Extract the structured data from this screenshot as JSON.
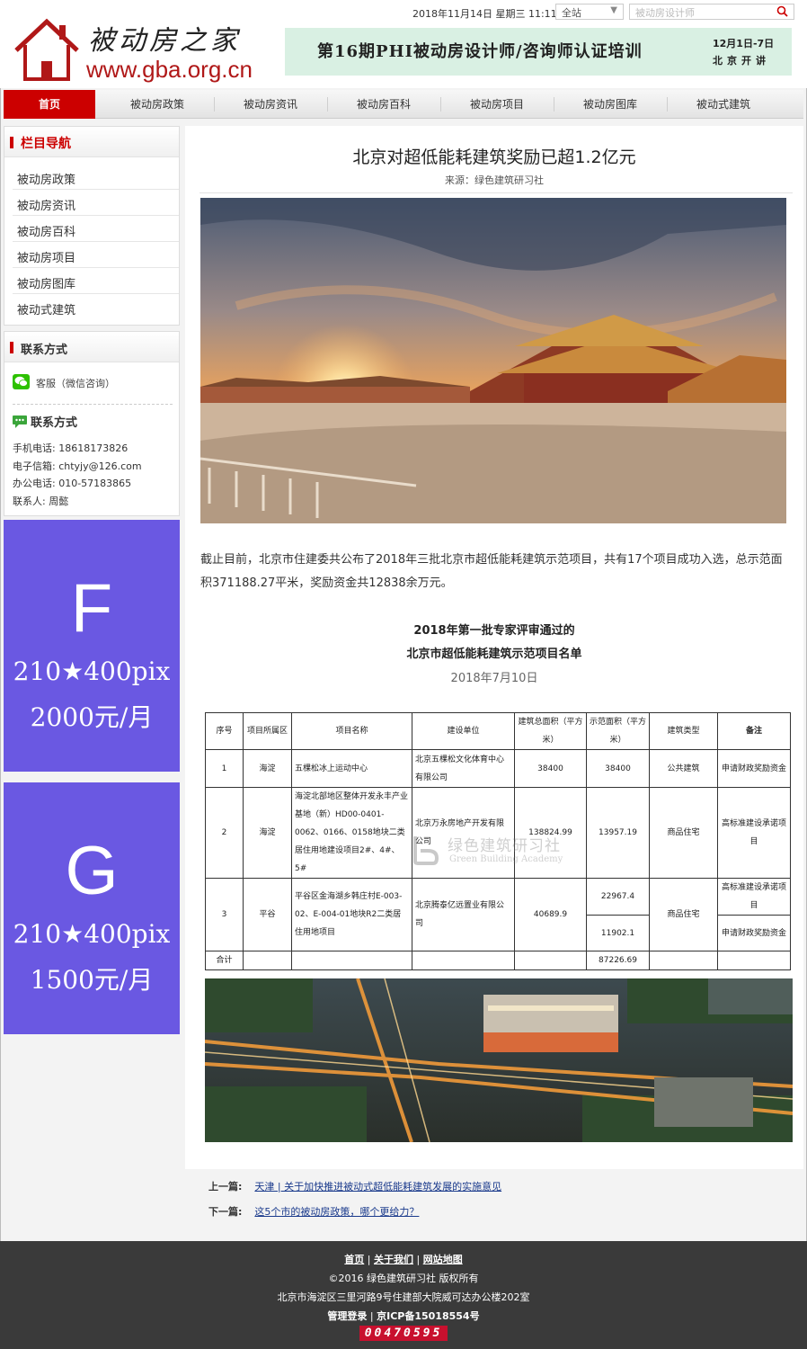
{
  "header": {
    "logo_text": "被动房之家",
    "logo_url": "www.gba.org.cn",
    "datetime": "2018年11月14日 星期三 11:11",
    "site_select": "全站",
    "search_placeholder": "被动房设计师",
    "banner_title": "第16期PHI被动房设计师/咨询师认证培训",
    "banner_date": "12月1日-7日",
    "banner_place": "北京开讲"
  },
  "nav": [
    "首页",
    "被动房政策",
    "被动房资讯",
    "被动房百科",
    "被动房项目",
    "被动房图库",
    "被动式建筑"
  ],
  "sidebar": {
    "nav_title": "栏目导航",
    "links": [
      "被动房政策",
      "被动房资讯",
      "被动房百科",
      "被动房项目",
      "被动房图库",
      "被动式建筑"
    ],
    "contact_title": "联系方式",
    "wechat": "客服（微信咨询）",
    "contact_sub_title": "联系方式",
    "phone": "手机电话: 18618173826",
    "email": "电子信箱: chtyjy@126.com",
    "office": "办公电话: 010-57183865",
    "person": "联系人: 周懿"
  },
  "ads": [
    {
      "letter": "F",
      "size": "210★400pix",
      "price": "2000元/月"
    },
    {
      "letter": "G",
      "size": "210★400pix",
      "price": "1500元/月"
    }
  ],
  "article": {
    "title": "北京对超低能耗建筑奖励已超1.2亿元",
    "source": "来源：绿色建筑研习社",
    "paragraph": "截止目前，北京市住建委共公布了2018年三批北京市超低能耗建筑示范项目，共有17个项目成功入选，总示范面积371188.27平米，奖励资金共12838余万元。",
    "subtitle1": "2018年第一批专家评审通过的",
    "subtitle2": "北京市超低能耗建筑示范项目名单",
    "subtitle3": "2018年7月10日"
  },
  "table": {
    "headers": [
      "序号",
      "项目所属区",
      "项目名称",
      "建设单位",
      "建筑总面积（平方米）",
      "示范面积（平方米）",
      "建筑类型",
      "备注"
    ],
    "rows": [
      {
        "no": "1",
        "district": "海淀",
        "name": "五棵松冰上运动中心",
        "unit": "北京五棵松文化体育中心有限公司",
        "total": "38400",
        "demo": "38400",
        "type": "公共建筑",
        "note": "申请财政奖励资金"
      },
      {
        "no": "2",
        "district": "海淀",
        "name": "海淀北部地区整体开发永丰产业基地（新）HD00-0401-0062、0166、0158地块二类居住用地建设项目2#、4#、5#",
        "unit": "北京万永房地产开发有限公司",
        "total": "138824.99",
        "demo": "13957.19",
        "type": "商品住宅",
        "note": "高标准建设承诺项目"
      },
      {
        "no": "3",
        "district": "平谷",
        "name": "平谷区金海湖乡韩庄村E-003-02、E-004-01地块R2二类居住用地项目",
        "unit": "北京腾泰亿远置业有限公司",
        "total": "40689.9",
        "demo_a": "22967.4",
        "demo_b": "11902.1",
        "type": "商品住宅",
        "note_a": "高标准建设承诺项目",
        "note_b": "申请财政奖励资金"
      }
    ],
    "total_label": "合计",
    "total_value": "87226.69"
  },
  "watermark": {
    "name": "绿色建筑研习社",
    "en": "Green Building Academy"
  },
  "pager": {
    "prev_label": "上一篇:",
    "prev_title": "天津 | 关于加快推进被动式超低能耗建筑发展的实施意见",
    "next_label": "下一篇:",
    "next_title": "这5个市的被动房政策，哪个更给力？"
  },
  "footer": {
    "links": [
      "首页",
      "关于我们",
      "网站地图"
    ],
    "copyright": "©2016 绿色建筑研习社 版权所有",
    "address": "北京市海淀区三里河路9号住建部大院威可达办公楼202室",
    "admin": "管理登录",
    "icp": "京ICP备15018554号",
    "counter": "00470595"
  },
  "colors": {
    "brand_red": "#cc0000",
    "ad_purple": "#6a58e2",
    "banner_green": "#d9f0e3",
    "footer_bg": "#3a3a3a"
  }
}
